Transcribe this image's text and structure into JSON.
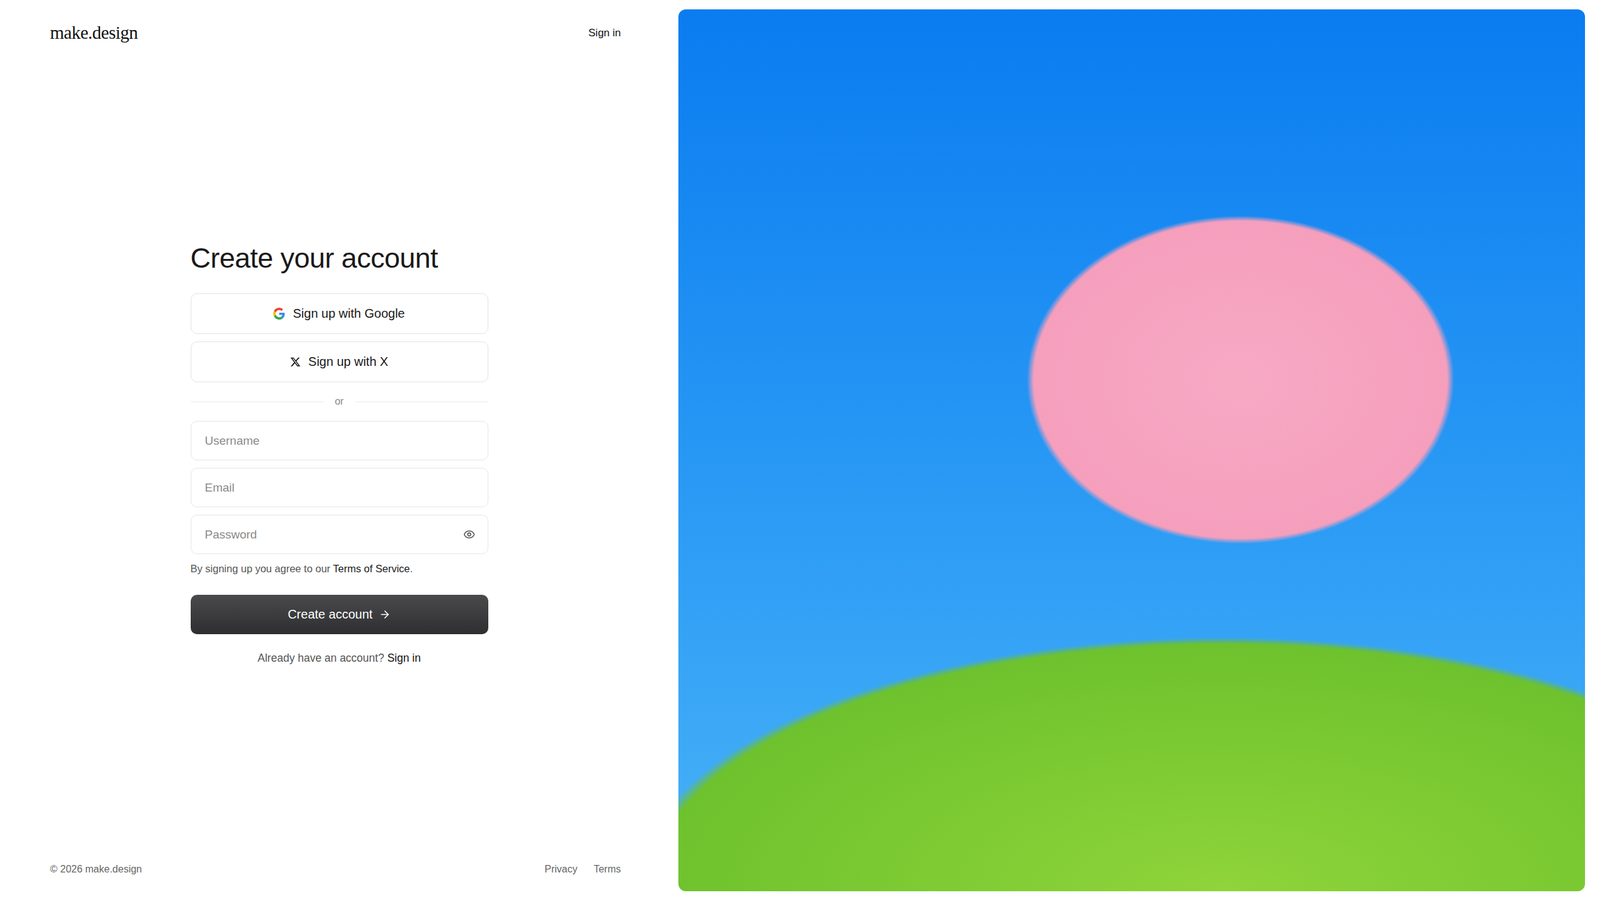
{
  "header": {
    "logo": "make.design",
    "nav_link": "Sign in"
  },
  "form": {
    "title": "Create your account",
    "social_buttons": [
      {
        "label": "Sign up with Google",
        "provider": "google"
      },
      {
        "label": "Sign up with X",
        "provider": "x"
      }
    ],
    "divider": "or",
    "fields": [
      {
        "placeholder": "Username",
        "kind": "text"
      },
      {
        "placeholder": "Email",
        "kind": "email"
      },
      {
        "placeholder": "Password",
        "kind": "password"
      }
    ],
    "terms": {
      "prefix": "By signing up you agree to our ",
      "link": "Terms of Service",
      "suffix": "."
    },
    "submit": "Create account",
    "signin_prompt": {
      "text": "Already have an account?",
      "link": "Sign in"
    }
  },
  "footer": {
    "copyright": "© 2026 make.design",
    "links": [
      "Privacy",
      "Terms"
    ]
  }
}
